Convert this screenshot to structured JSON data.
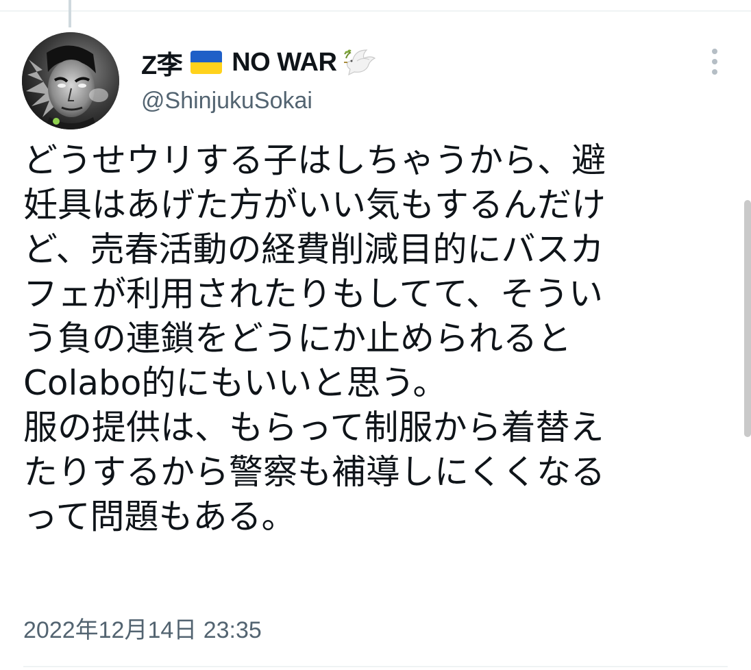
{
  "author": {
    "name": "Z李",
    "name_suffix": "NO WAR",
    "handle": "@ShinjukuSokai",
    "avatar_icon": "avatar-portrait-icon",
    "flag_icon": "ukraine-flag-icon",
    "dove_icon": "peace-dove-icon",
    "flag_colors": {
      "top": "#1f5fc7",
      "bottom": "#ffd21c"
    }
  },
  "more_icon": "more-options-icon",
  "tweet": {
    "lines": [
      "どうせウリする子はしちゃうから、避",
      "妊具はあげた方がいい気もするんだけ",
      "ど、売春活動の経費削減目的にバスカ",
      "フェが利用されたりもしてて、そうい",
      "う負の連鎖をどうにか止められると",
      "Colabo的にもいいと思う。",
      "服の提供は、もらって制服から着替え",
      "たりするから警察も補導しにくくなる",
      "って問題もある。"
    ],
    "timestamp": "2022年12月14日 23:35"
  },
  "colors": {
    "text": "#0f1419",
    "secondary_text": "#536471",
    "divider": "#eff3f4"
  }
}
